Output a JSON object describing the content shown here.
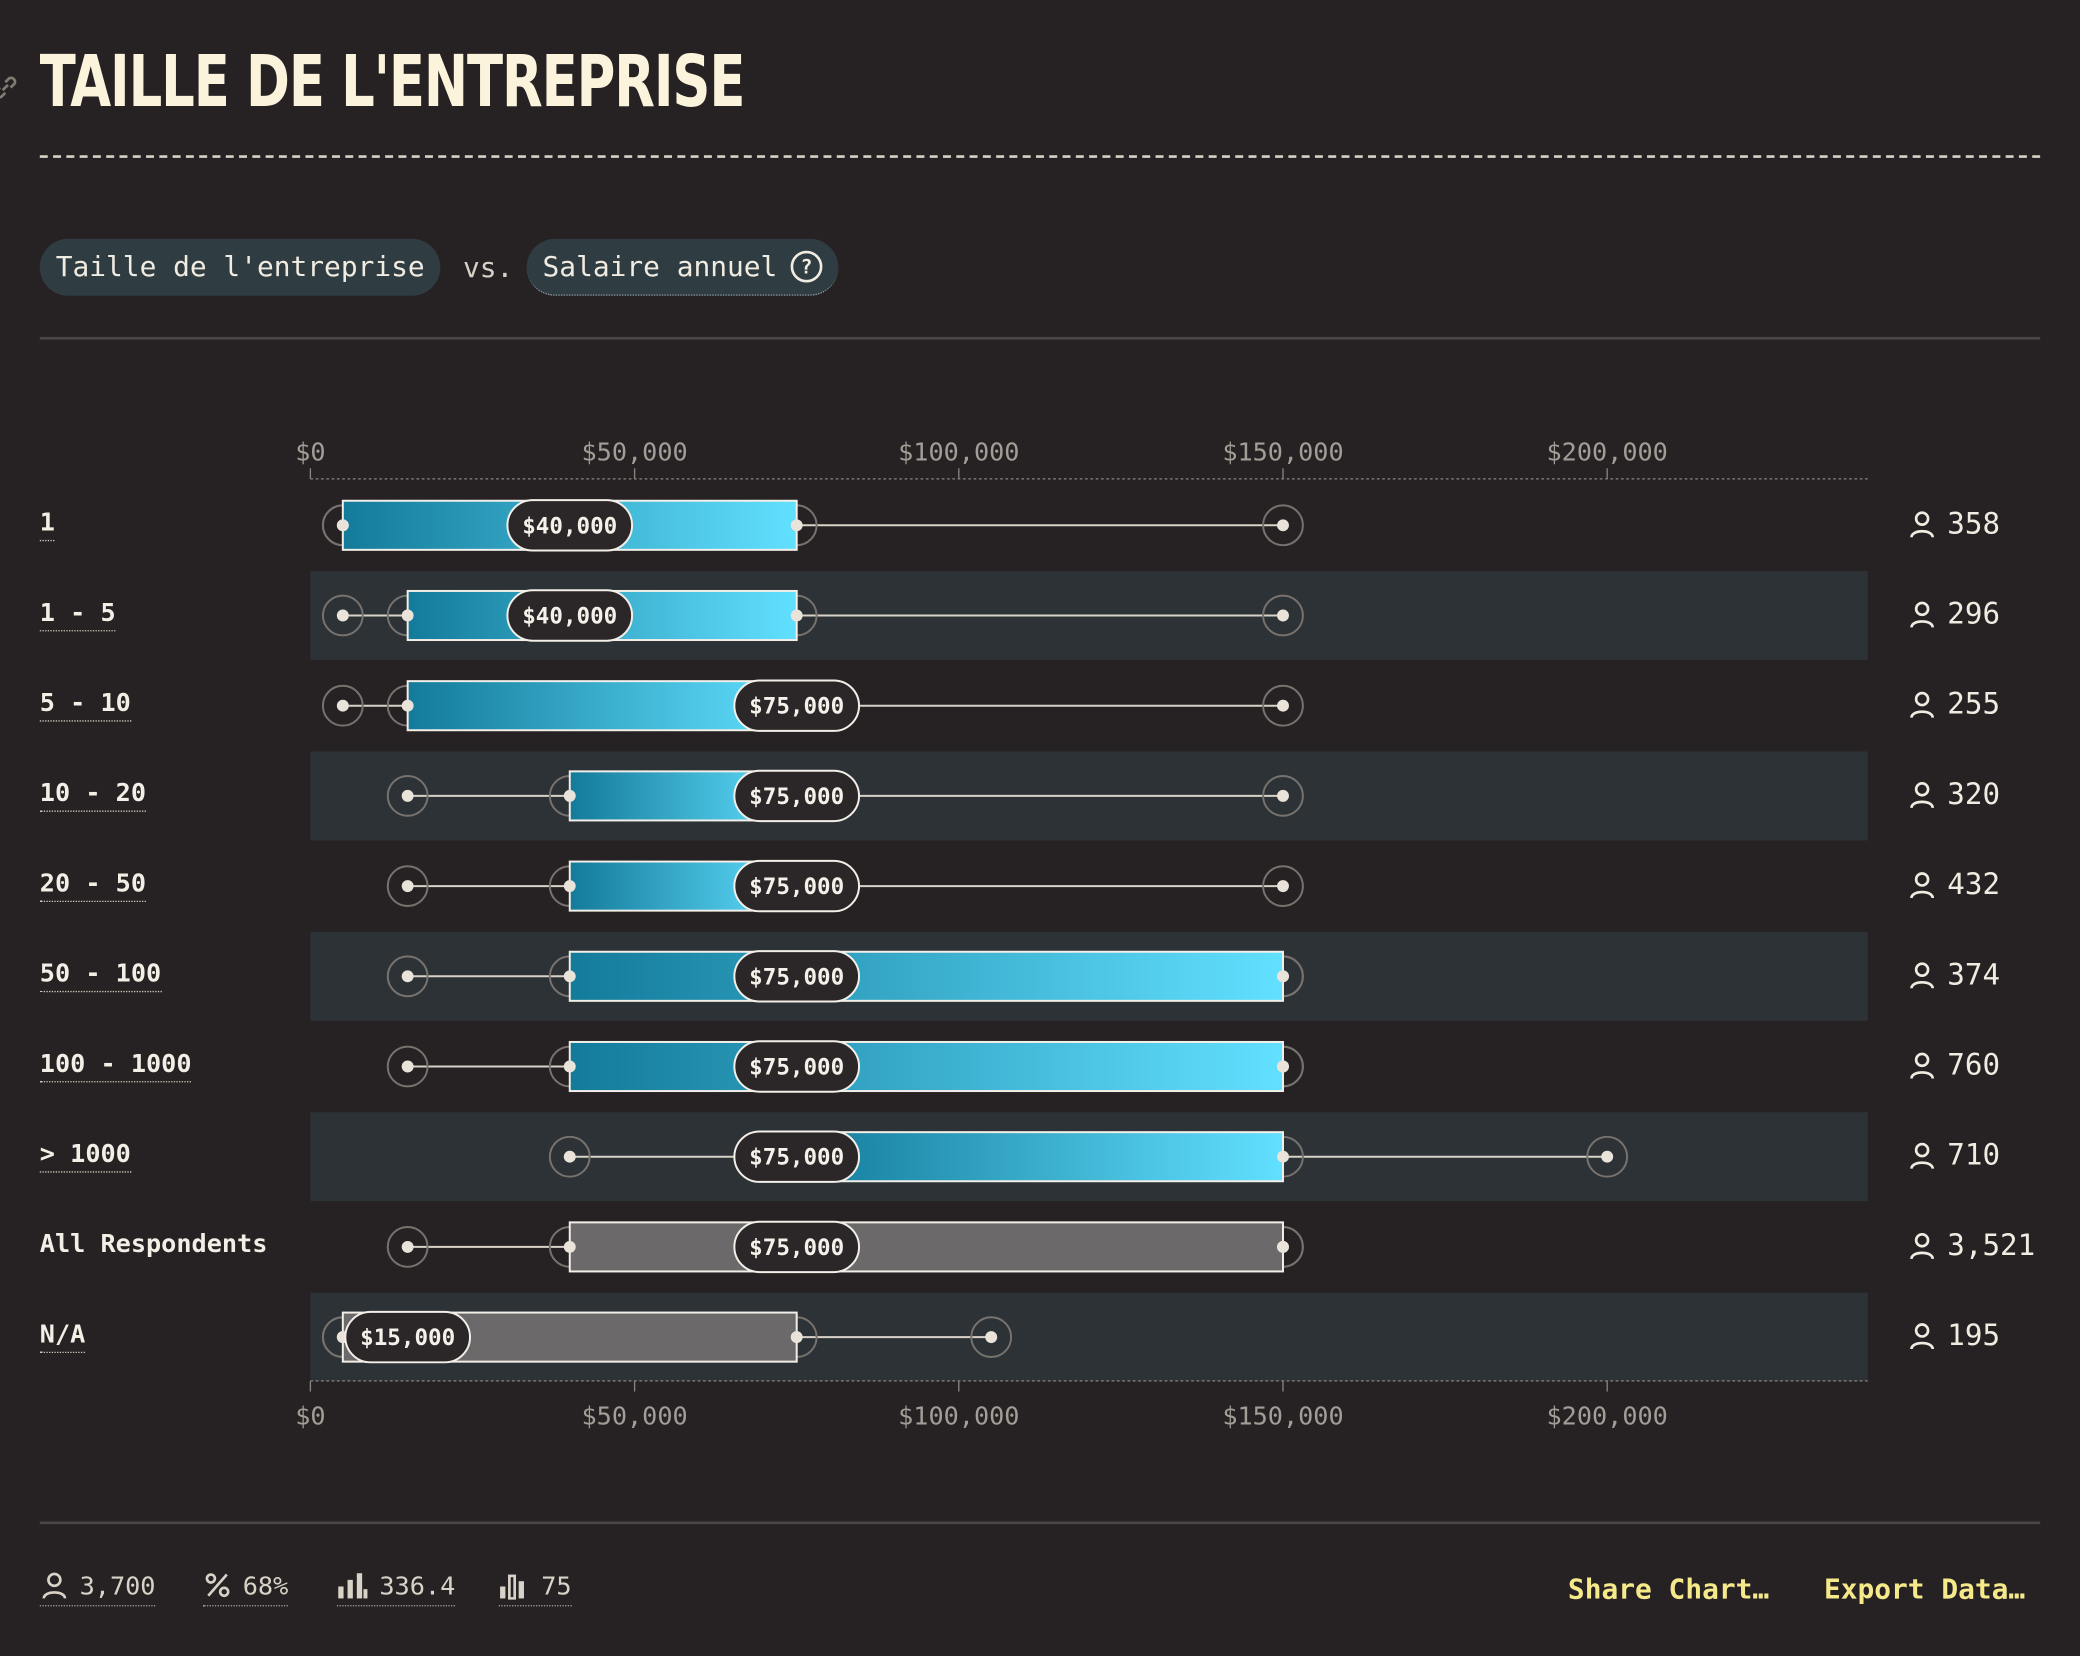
{
  "title": "TAILLE DE L'ENTREPRISE",
  "controls": {
    "field_a": "Taille de l'entreprise",
    "vs": "vs.",
    "field_b": "Salaire annuel",
    "help_glyph": "?"
  },
  "chart_data": {
    "type": "box",
    "x_axis": {
      "ticks": [
        0,
        50000,
        100000,
        150000,
        200000
      ],
      "tick_labels": [
        "$0",
        "$50,000",
        "$100,000",
        "$150,000",
        "$200,000"
      ],
      "range": [
        0,
        240000
      ]
    },
    "rows": [
      {
        "label": "1",
        "min": 5000,
        "q1": 5000,
        "median": 40000,
        "q3": 75000,
        "max": 150000,
        "median_label": "$40,000",
        "count": "358",
        "style": "highlight"
      },
      {
        "label": "1 - 5",
        "min": 5000,
        "q1": 15000,
        "median": 40000,
        "q3": 75000,
        "max": 150000,
        "median_label": "$40,000",
        "count": "296",
        "style": "highlight"
      },
      {
        "label": "5 - 10",
        "min": 5000,
        "q1": 15000,
        "median": 75000,
        "q3": 75000,
        "max": 150000,
        "median_label": "$75,000",
        "count": "255",
        "style": "highlight"
      },
      {
        "label": "10 - 20",
        "min": 15000,
        "q1": 40000,
        "median": 75000,
        "q3": 75000,
        "max": 150000,
        "median_label": "$75,000",
        "count": "320",
        "style": "highlight"
      },
      {
        "label": "20 - 50",
        "min": 15000,
        "q1": 40000,
        "median": 75000,
        "q3": 75000,
        "max": 150000,
        "median_label": "$75,000",
        "count": "432",
        "style": "highlight"
      },
      {
        "label": "50 - 100",
        "min": 15000,
        "q1": 40000,
        "median": 75000,
        "q3": 150000,
        "max": 150000,
        "median_label": "$75,000",
        "count": "374",
        "style": "highlight"
      },
      {
        "label": "100 - 1000",
        "min": 15000,
        "q1": 40000,
        "median": 75000,
        "q3": 150000,
        "max": 150000,
        "median_label": "$75,000",
        "count": "760",
        "style": "highlight"
      },
      {
        "label": "> 1000",
        "min": 40000,
        "q1": 75000,
        "median": 75000,
        "q3": 150000,
        "max": 200000,
        "median_label": "$75,000",
        "count": "710",
        "style": "highlight"
      },
      {
        "label": "All Respondents",
        "min": 15000,
        "q1": 40000,
        "median": 75000,
        "q3": 150000,
        "max": 150000,
        "median_label": "$75,000",
        "count": "3,521",
        "style": "muted"
      },
      {
        "label": "N/A",
        "min": 5000,
        "q1": 5000,
        "median": 15000,
        "q3": 75000,
        "max": 105000,
        "median_label": "$15,000",
        "count": "195",
        "style": "muted"
      }
    ]
  },
  "stats": {
    "respondents": "3,700",
    "percent": "68%",
    "average": "336.4",
    "median": "75"
  },
  "actions": {
    "share": "Share Chart…",
    "export": "Export Data…"
  },
  "colors": {
    "background": "#262223",
    "band": "#2c3235",
    "bar_start": "#137a9a",
    "bar_end": "#62e0ff",
    "muted_bar": "#6b6969",
    "accent_text": "#f5e98a"
  },
  "icons": [
    "link-icon",
    "help-icon",
    "person-icon",
    "percent-icon",
    "bar-chart-icon",
    "median-bar-icon"
  ]
}
